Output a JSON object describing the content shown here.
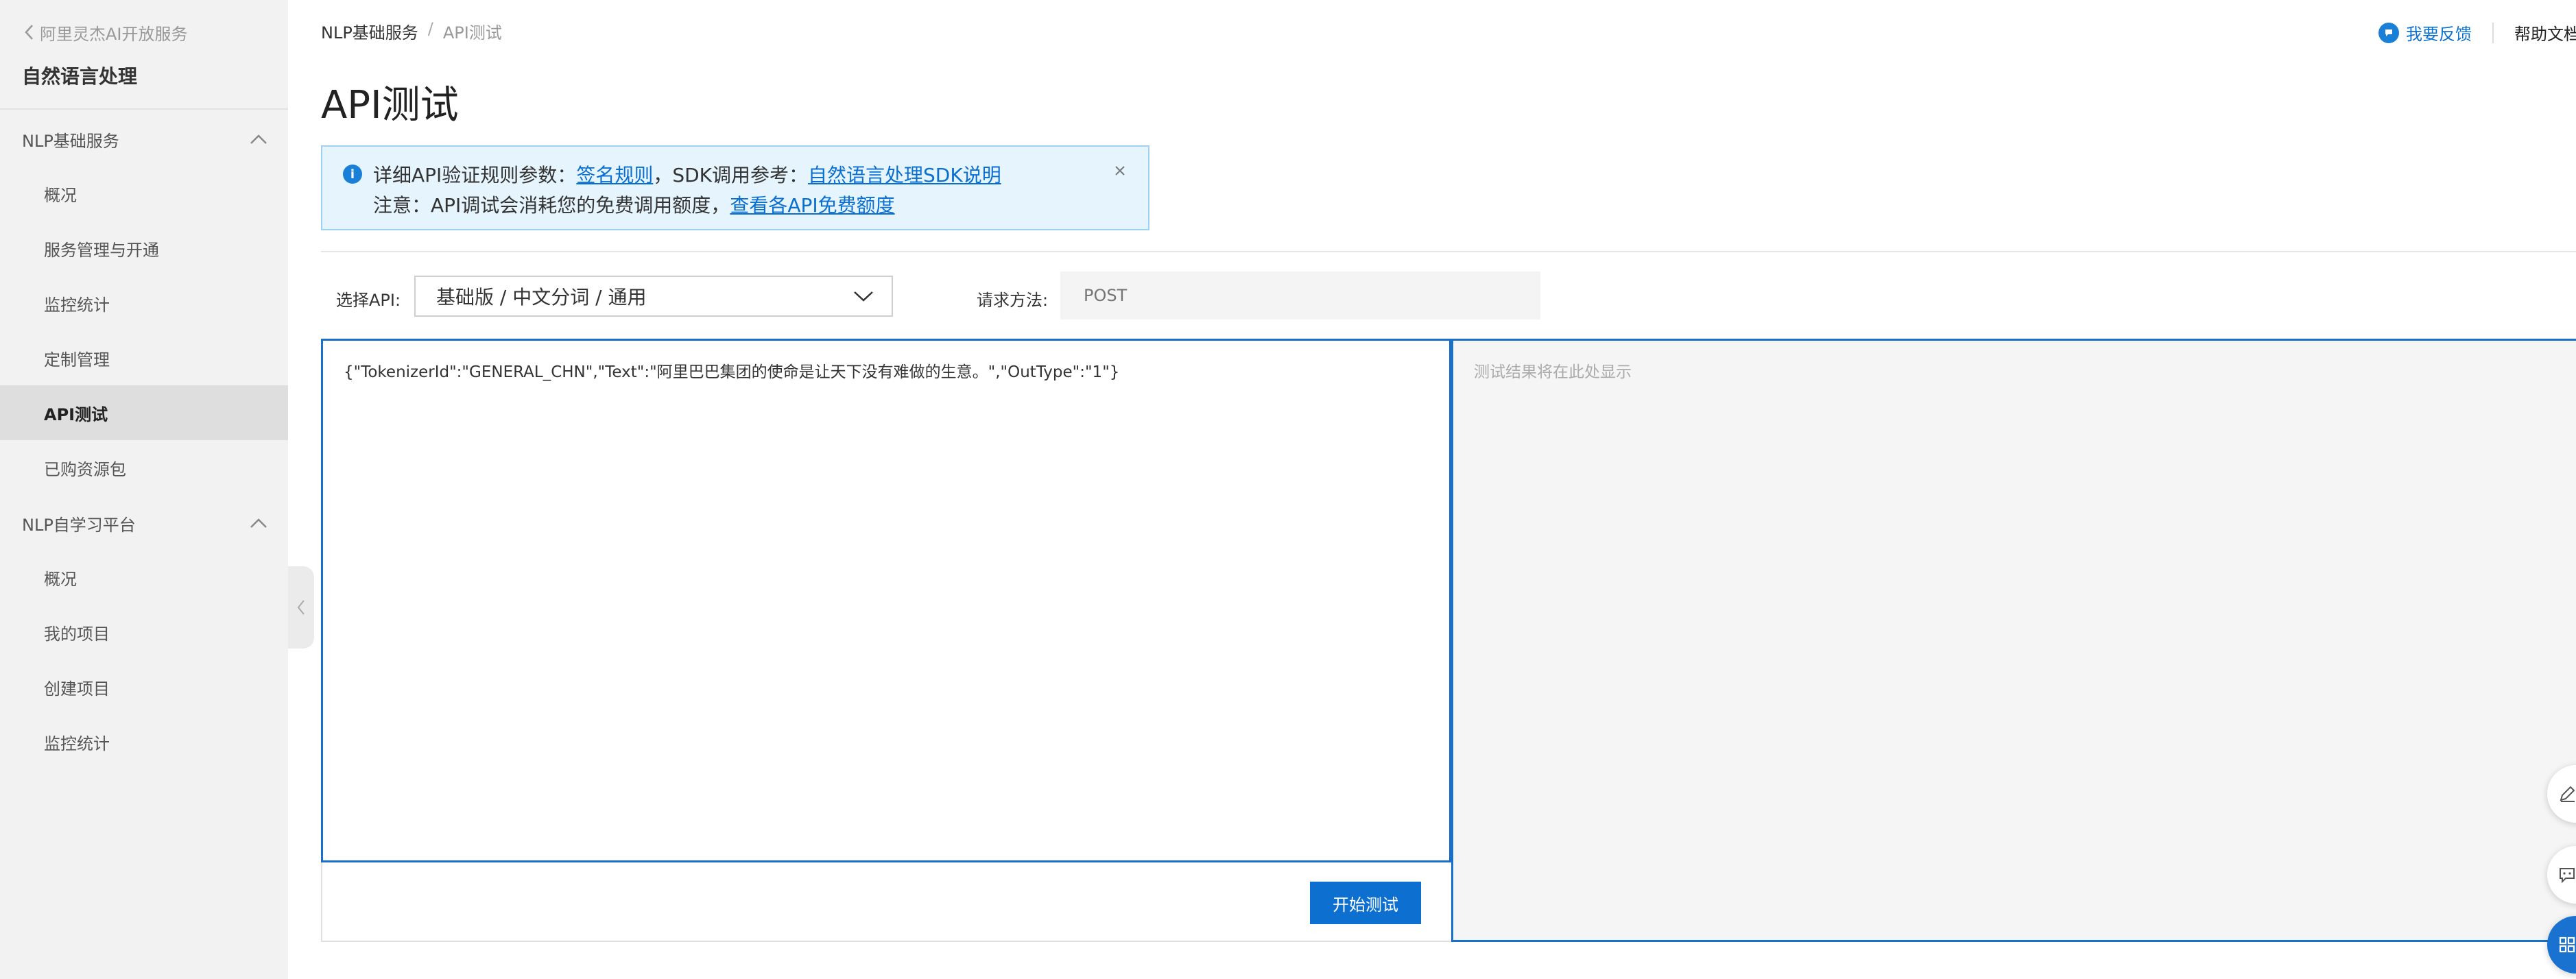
{
  "sidebar": {
    "back_label": "阿里灵杰AI开放服务",
    "title": "自然语言处理",
    "groups": [
      {
        "label": "NLP基础服务",
        "items": [
          "概况",
          "服务管理与开通",
          "监控统计",
          "定制管理",
          "API测试",
          "已购资源包"
        ]
      },
      {
        "label": "NLP自学习平台",
        "items": [
          "概况",
          "我的项目",
          "创建项目",
          "监控统计"
        ]
      }
    ],
    "active_item": "API测试"
  },
  "breadcrumb": {
    "parent": "NLP基础服务",
    "separator": "/",
    "current": "API测试"
  },
  "header": {
    "feedback": "我要反馈",
    "help": "帮助文档"
  },
  "page_title": "API测试",
  "notice": {
    "line1_prefix": "详细API验证规则参数：",
    "link_sign": "签名规则",
    "line1_middle": "，SDK调用参考：",
    "link_sdk": "自然语言处理SDK说明",
    "line2_prefix": "注意：API调试会消耗您的免费调用额度，",
    "link_quota": "查看各API免费额度"
  },
  "form": {
    "select_api_label": "选择API:",
    "select_api_value": "基础版 / 中文分词 / 通用",
    "method_label": "请求方法:",
    "method_placeholder": "POST"
  },
  "editor": {
    "value": "{\"TokenizerId\":\"GENERAL_CHN\",\"Text\":\"阿里巴巴集团的使命是让天下没有难做的生意。\",\"OutType\":\"1\"}"
  },
  "result": {
    "placeholder": "测试结果将在此处显示"
  },
  "start_button": "开始测试",
  "colors": {
    "accent": "#0d6fcf",
    "sidebar_bg": "#f2f2f2",
    "active_bg": "#dedede",
    "notice_bg": "#e5f4fd"
  }
}
